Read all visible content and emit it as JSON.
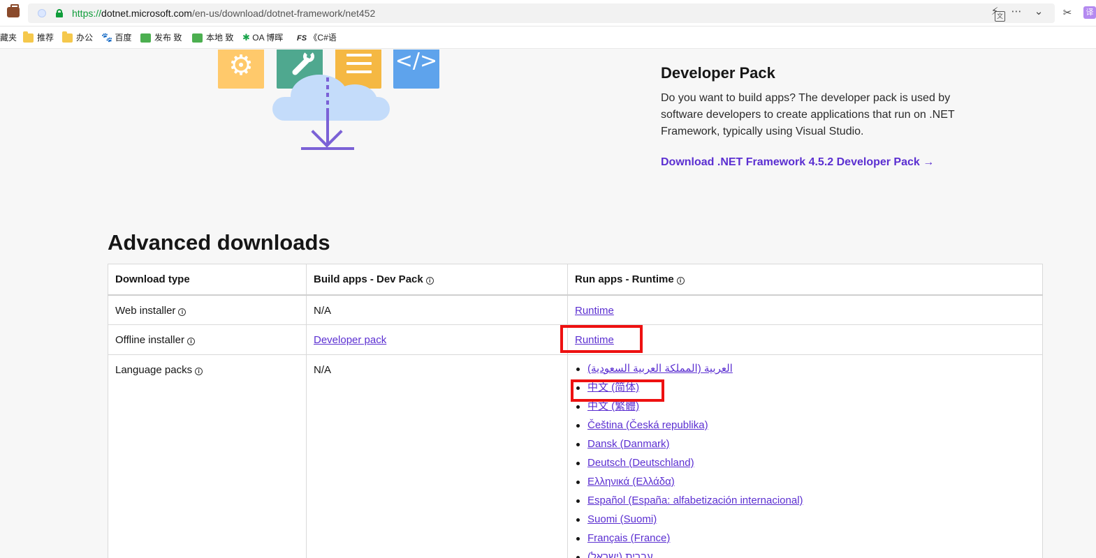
{
  "browser": {
    "url_scheme": "https://",
    "url_host": "dotnet.microsoft.com",
    "url_path": "/en-us/download/dotnet-framework/net452",
    "extension_label": "译",
    "bookmarks": [
      {
        "label": "藏夹",
        "icon": "none"
      },
      {
        "label": "推荐",
        "icon": "folder-icon"
      },
      {
        "label": "办公",
        "icon": "folder-icon"
      },
      {
        "label": "百度",
        "icon": "baidu-paw-icon"
      },
      {
        "label": "发布 致",
        "icon": "green-page-icon"
      },
      {
        "label": "本地 致",
        "icon": "green-page-icon"
      },
      {
        "label": "OA 博晖",
        "icon": "oa-icon"
      },
      {
        "label": "《C#语",
        "icon": "fs-icon"
      }
    ]
  },
  "developer_pack": {
    "title": "Developer Pack",
    "description": "Do you want to build apps? The developer pack is used by software developers to create applications that run on .NET Framework, typically using Visual Studio.",
    "download_link": "Download .NET Framework 4.5.2 Developer Pack →"
  },
  "advanced": {
    "title": "Advanced downloads",
    "headers": [
      "Download type",
      "Build apps - Dev Pack",
      "Run apps - Runtime"
    ],
    "rows": [
      {
        "type": "Web installer",
        "dev": "N/A",
        "dev_is_link": false,
        "runtime": "Runtime"
      },
      {
        "type": "Offline installer",
        "dev": "Developer pack",
        "dev_is_link": true,
        "runtime": "Runtime"
      },
      {
        "type": "Language packs",
        "dev": "N/A",
        "dev_is_link": false
      }
    ],
    "languages": [
      "العربية (المملكة العربية السعودية)",
      "中文 (简体)",
      "中文 (繁體)",
      "Čeština (Česká republika)",
      "Dansk (Danmark)",
      "Deutsch (Deutschland)",
      "Ελληνικά (Ελλάδα)",
      "Español (España: alfabetización internacional)",
      "Suomi (Suomi)",
      "Français (France)",
      "עברית (ישראל)"
    ]
  },
  "highlight_color": "#ee1111",
  "link_color": "#5b2fd1"
}
